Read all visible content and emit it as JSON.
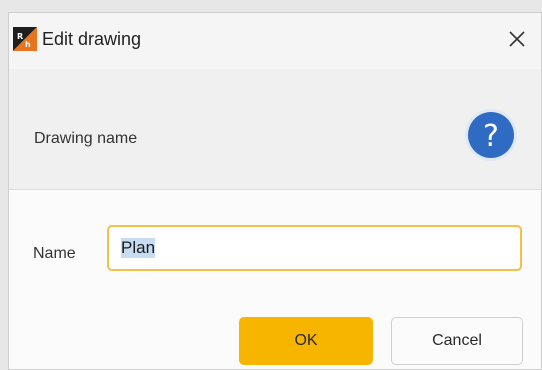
{
  "dialog": {
    "title": "Edit drawing",
    "app_icon": "app-logo-icon",
    "close_icon": "close-icon"
  },
  "header": {
    "label": "Drawing name",
    "help_icon": "help-icon"
  },
  "form": {
    "name_label": "Name",
    "name_value": "Plan"
  },
  "buttons": {
    "ok_label": "OK",
    "cancel_label": "Cancel"
  },
  "colors": {
    "accent": "#f7b500",
    "input_border": "#f3c04a",
    "help_blue": "#2f6bc3",
    "selection": "#c6dcf3"
  }
}
